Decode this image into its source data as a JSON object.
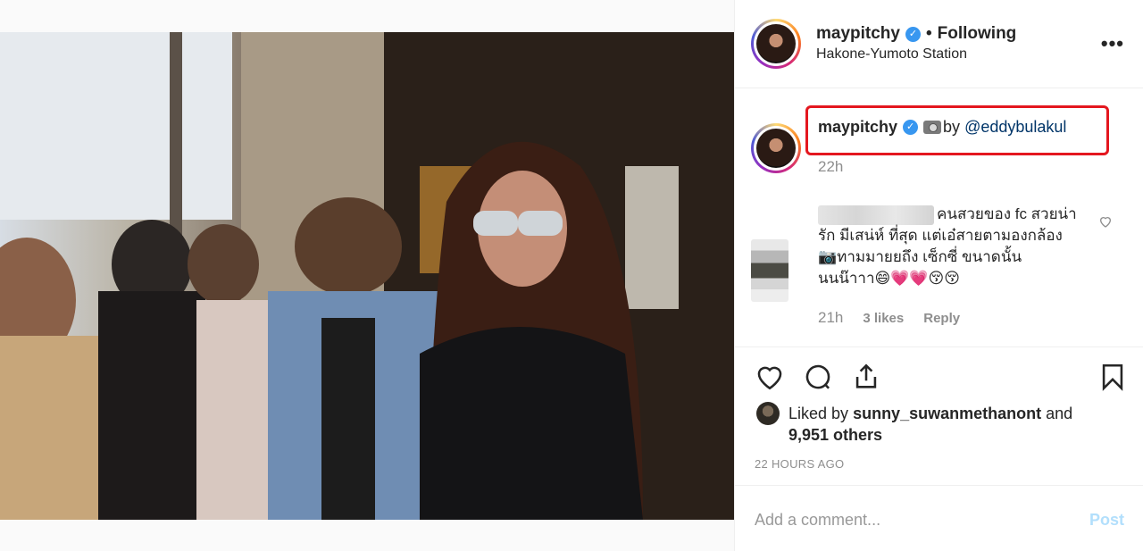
{
  "post": {
    "photo_alt": "woman with long dark hair wearing mirrored sunglasses on a crowded street"
  },
  "header": {
    "username": "maypitchy",
    "separator": "•",
    "follow_status": "Following",
    "location": "Hakone-Yumoto Station",
    "more_glyph": "•••"
  },
  "caption": {
    "username": "maypitchy",
    "text_by": "by",
    "mention": "@eddybulakul",
    "time": "22h",
    "highlight_color": "#e4171f"
  },
  "comment": {
    "text": "คนสวยของ fc สวยน่ารัก มีเสน่ห์ ที่สุด แต่เอ๋สายตามองกล้อง📷ทามมายยถึง เซ็กซี่ ขนาดนั้นนนน๊าาา😄💗💗😚😚",
    "time": "21h",
    "likes": "3 likes",
    "reply": "Reply"
  },
  "actions": {
    "liked_prefix": "Liked by",
    "liked_user": "sunny_suwanmethanont",
    "liked_and": "and",
    "liked_others": "9,951 others",
    "timestamp": "22 HOURS AGO"
  },
  "add_comment": {
    "placeholder": "Add a comment...",
    "post_label": "Post",
    "post_color": "#b2dffc"
  },
  "colors": {
    "verified": "#3897f0",
    "mention": "#003569",
    "muted": "#8e8e8e"
  }
}
